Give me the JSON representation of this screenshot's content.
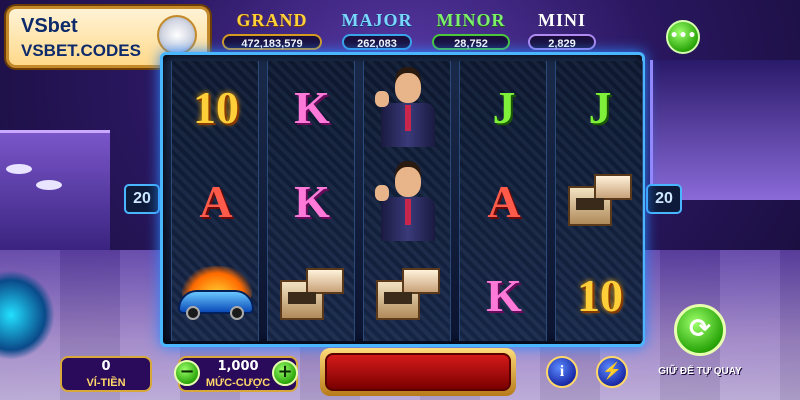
{
  "logo": {
    "brand": "VSbet",
    "domain": "VSBET.CODES",
    "emblem_icon": "crest-emblem-icon"
  },
  "jackpots": [
    {
      "name": "GRAND",
      "value": "472,183,579",
      "color": "#ffd23a"
    },
    {
      "name": "MAJOR",
      "value": "262,083",
      "color": "#7ad8ff"
    },
    {
      "name": "MINOR",
      "value": "28,752",
      "color": "#7cf06a"
    },
    {
      "name": "MINI",
      "value": "2,829",
      "color": "#ffffff"
    }
  ],
  "menu": {
    "icon": "more-dots-icon",
    "glyph": "•••"
  },
  "paylines": {
    "left": "20",
    "right": "20"
  },
  "reels": [
    [
      "10",
      "A",
      "car"
    ],
    [
      "K",
      "K",
      "house"
    ],
    [
      "man",
      "man",
      "house"
    ],
    [
      "J",
      "A",
      "K"
    ],
    [
      "J",
      "house",
      "10"
    ]
  ],
  "controls": {
    "wallet_value": "0",
    "wallet_label": "VÍ-TIỀN",
    "bet_value": "1,000",
    "bet_label": "MỨC-CƯỢC",
    "minus_glyph": "−",
    "plus_glyph": "+",
    "info_glyph": "i",
    "bolt_glyph": "⚡",
    "autospin_glyph": "⟳",
    "autospin_label": "GIỮ ĐỂ TỰ QUAY"
  }
}
